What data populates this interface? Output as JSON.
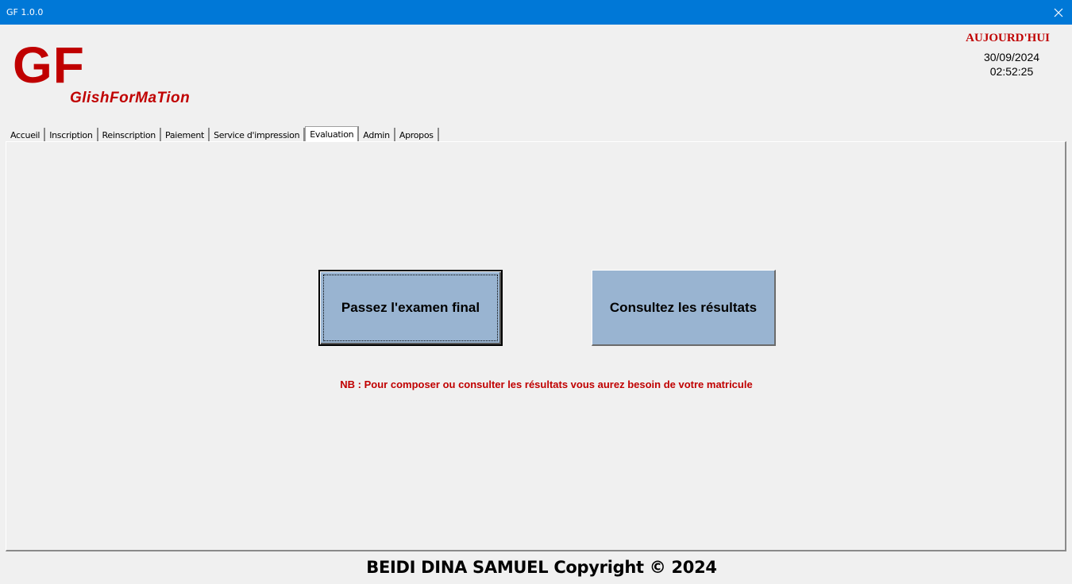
{
  "window": {
    "title": "GF 1.0.0",
    "close_icon": "close-icon"
  },
  "logo": {
    "main": "GF",
    "subtitle": "GlishForMaTion"
  },
  "today": {
    "label": "AUJOURD'HUI",
    "date": "30/09/2024",
    "time": "02:52:25"
  },
  "tabs": [
    {
      "label": "Accueil"
    },
    {
      "label": "Inscription"
    },
    {
      "label": "Reinscription"
    },
    {
      "label": "Paiement"
    },
    {
      "label": "Service d'impression"
    },
    {
      "label": "Evaluation",
      "active": true
    },
    {
      "label": "Admin"
    },
    {
      "label": "Apropos"
    }
  ],
  "evaluation": {
    "exam_button": "Passez l'examen final",
    "results_button": "Consultez les résultats",
    "note": "NB : Pour composer ou consulter les résultats vous aurez besoin de votre matricule"
  },
  "footer": "BEIDI DINA SAMUEL Copyright © 2024",
  "colors": {
    "titlebar": "#0078d7",
    "brand_red": "#c00000",
    "button_blue": "#99b4d1",
    "background": "#f0f0f0"
  }
}
